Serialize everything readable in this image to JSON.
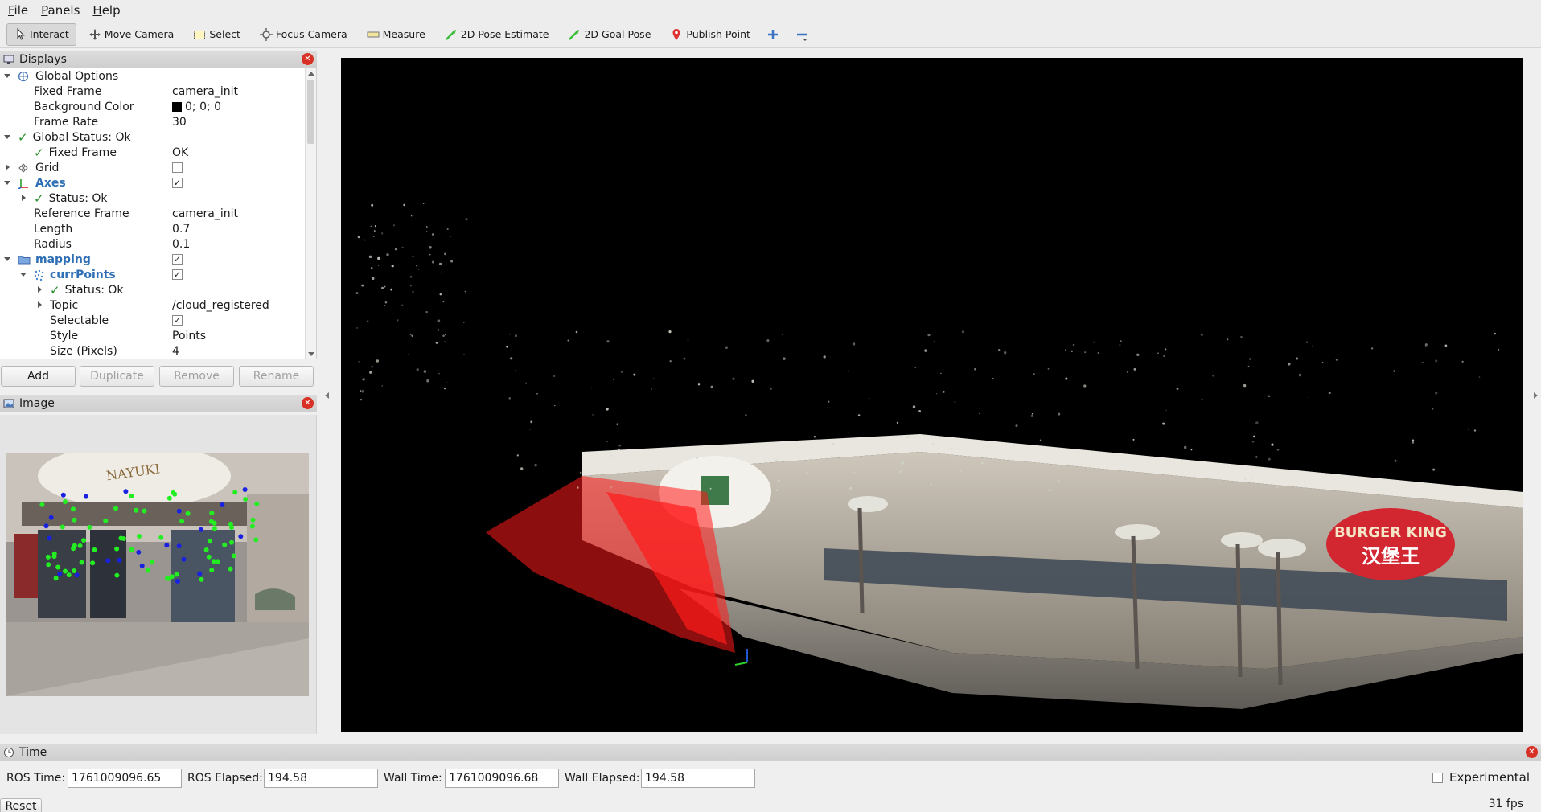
{
  "menu": [
    "File",
    "Panels",
    "Help"
  ],
  "toolbar": {
    "tools": [
      {
        "label": "Interact",
        "icon": "cursor-icon",
        "active": true
      },
      {
        "label": "Move Camera",
        "icon": "move-camera-icon"
      },
      {
        "label": "Select",
        "icon": "select-box-icon"
      },
      {
        "label": "Focus Camera",
        "icon": "focus-camera-icon"
      },
      {
        "label": "Measure",
        "icon": "ruler-icon"
      },
      {
        "label": "2D Pose Estimate",
        "icon": "pose-arrow-icon"
      },
      {
        "label": "2D Goal Pose",
        "icon": "goal-arrow-icon"
      },
      {
        "label": "Publish Point",
        "icon": "map-pin-icon"
      }
    ]
  },
  "displays": {
    "title": "Displays",
    "rows": [
      {
        "label": "Global Options",
        "value": ""
      },
      {
        "label": "Fixed Frame",
        "value": "camera_init"
      },
      {
        "label": "Background Color",
        "value": "0; 0; 0"
      },
      {
        "label": "Frame Rate",
        "value": "30"
      },
      {
        "label": "Global Status: Ok",
        "value": ""
      },
      {
        "label": "Fixed Frame",
        "value": "OK"
      },
      {
        "label": "Grid",
        "value": ""
      },
      {
        "label": "Axes",
        "value": ""
      },
      {
        "label": "Status: Ok",
        "value": ""
      },
      {
        "label": "Reference Frame",
        "value": "camera_init"
      },
      {
        "label": "Length",
        "value": "0.7"
      },
      {
        "label": "Radius",
        "value": "0.1"
      },
      {
        "label": "mapping",
        "value": ""
      },
      {
        "label": "currPoints",
        "value": ""
      },
      {
        "label": "Status: Ok",
        "value": ""
      },
      {
        "label": "Topic",
        "value": "/cloud_registered"
      },
      {
        "label": "Selectable",
        "value": ""
      },
      {
        "label": "Style",
        "value": "Points"
      },
      {
        "label": "Size (Pixels)",
        "value": "4"
      }
    ],
    "buttons": {
      "add": "Add",
      "duplicate": "Duplicate",
      "remove": "Remove",
      "rename": "Rename"
    }
  },
  "image_panel": {
    "title": "Image",
    "sign_text": "NAYUKI"
  },
  "view3d": {
    "sign_burger": "BURGER KING",
    "sign_burger_cn": "汉堡王"
  },
  "time": {
    "title": "Time",
    "ros_time_label": "ROS Time:",
    "ros_time": "1761009096.65",
    "ros_elapsed_label": "ROS Elapsed:",
    "ros_elapsed": "194.58",
    "wall_time_label": "Wall Time:",
    "wall_time": "1761009096.68",
    "wall_elapsed_label": "Wall Elapsed:",
    "wall_elapsed": "194.58",
    "experimental_label": "Experimental",
    "reset_label": "Reset",
    "fps": "31 fps"
  },
  "colors": {
    "accent_blue": "#2f6fb5",
    "check_green": "#2a8c2a",
    "close_red": "#d93025",
    "cloud_red": "#ff1a1a"
  }
}
